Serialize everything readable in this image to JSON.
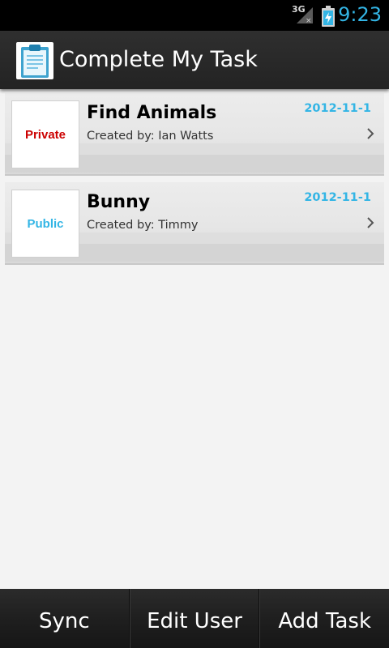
{
  "status_bar": {
    "network": "3G",
    "time": "9:23"
  },
  "action_bar": {
    "title": "Complete My Task",
    "icon": "clipboard-icon"
  },
  "tasks": [
    {
      "type": "Private",
      "type_color": "#cc0000",
      "title": "Find Animals",
      "creator": "Created by: Ian Watts",
      "date": "2012-11-1"
    },
    {
      "type": "Public",
      "type_color": "#33b5e5",
      "title": "Bunny",
      "creator": "Created by: Timmy",
      "date": "2012-11-1"
    }
  ],
  "bottom_bar": {
    "sync_label": "Sync",
    "edit_user_label": "Edit User",
    "add_task_label": "Add Task"
  },
  "colors": {
    "accent": "#33b5e5",
    "private": "#cc0000",
    "public": "#33b5e5"
  }
}
